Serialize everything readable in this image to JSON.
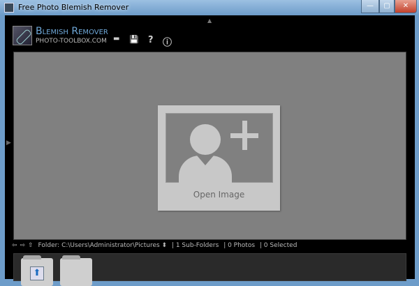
{
  "window": {
    "title": "Free Photo Blemish Remover",
    "min": "—",
    "max": "▢",
    "close": "✕"
  },
  "logo": {
    "title": "Blemish Remover",
    "subtitle": "PHOTO-TOOLBOX.COM"
  },
  "toolbar": {
    "open": "▬",
    "save": "💾",
    "help": "?",
    "info": "ⓘ"
  },
  "canvas": {
    "open_label": "Open Image"
  },
  "pathbar": {
    "back": "⇦",
    "forward": "⇨",
    "up": "⇧",
    "folder": "Folder: C:\\Users\\Administrator\\Pictures ⬍",
    "subfolders": "| 1 Sub-Folders",
    "photos": "| 0 Photos",
    "selected": "| 0 Selected"
  },
  "thumbs": {
    "up_arrow": "⬆"
  }
}
